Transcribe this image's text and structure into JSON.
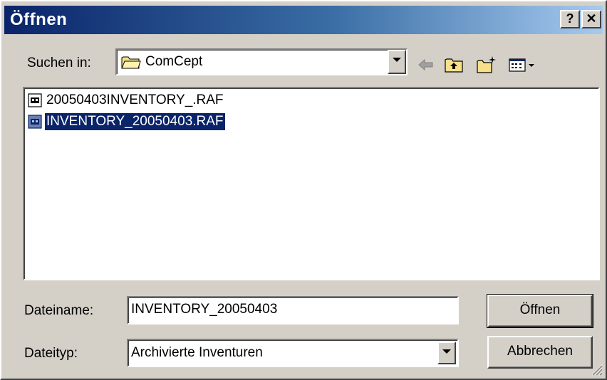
{
  "window": {
    "title": "Öffnen",
    "help_label": "?",
    "close_label": "✕"
  },
  "look_in": {
    "label": "Suchen in:",
    "value": "ComCept",
    "icon": "folder-icon"
  },
  "toolbar": {
    "back_icon": "back-arrow-icon",
    "up_icon": "up-folder-icon",
    "new_folder_icon": "new-folder-icon",
    "view_menu_icon": "view-menu-icon"
  },
  "files": [
    {
      "name": "20050403INVENTORY_.RAF",
      "selected": false,
      "icon": "raf-file-icon"
    },
    {
      "name": "INVENTORY_20050403.RAF",
      "selected": true,
      "icon": "raf-file-icon"
    }
  ],
  "filename": {
    "label": "Dateiname:",
    "value": "INVENTORY_20050403"
  },
  "filetype": {
    "label": "Dateityp:",
    "value": "Archivierte Inventuren"
  },
  "buttons": {
    "open": "Öffnen",
    "cancel": "Abbrechen"
  },
  "colors": {
    "title_gradient_start": "#0a246a",
    "title_gradient_end": "#a6caf0",
    "selection": "#0a246a",
    "face": "#d4d0c8"
  }
}
